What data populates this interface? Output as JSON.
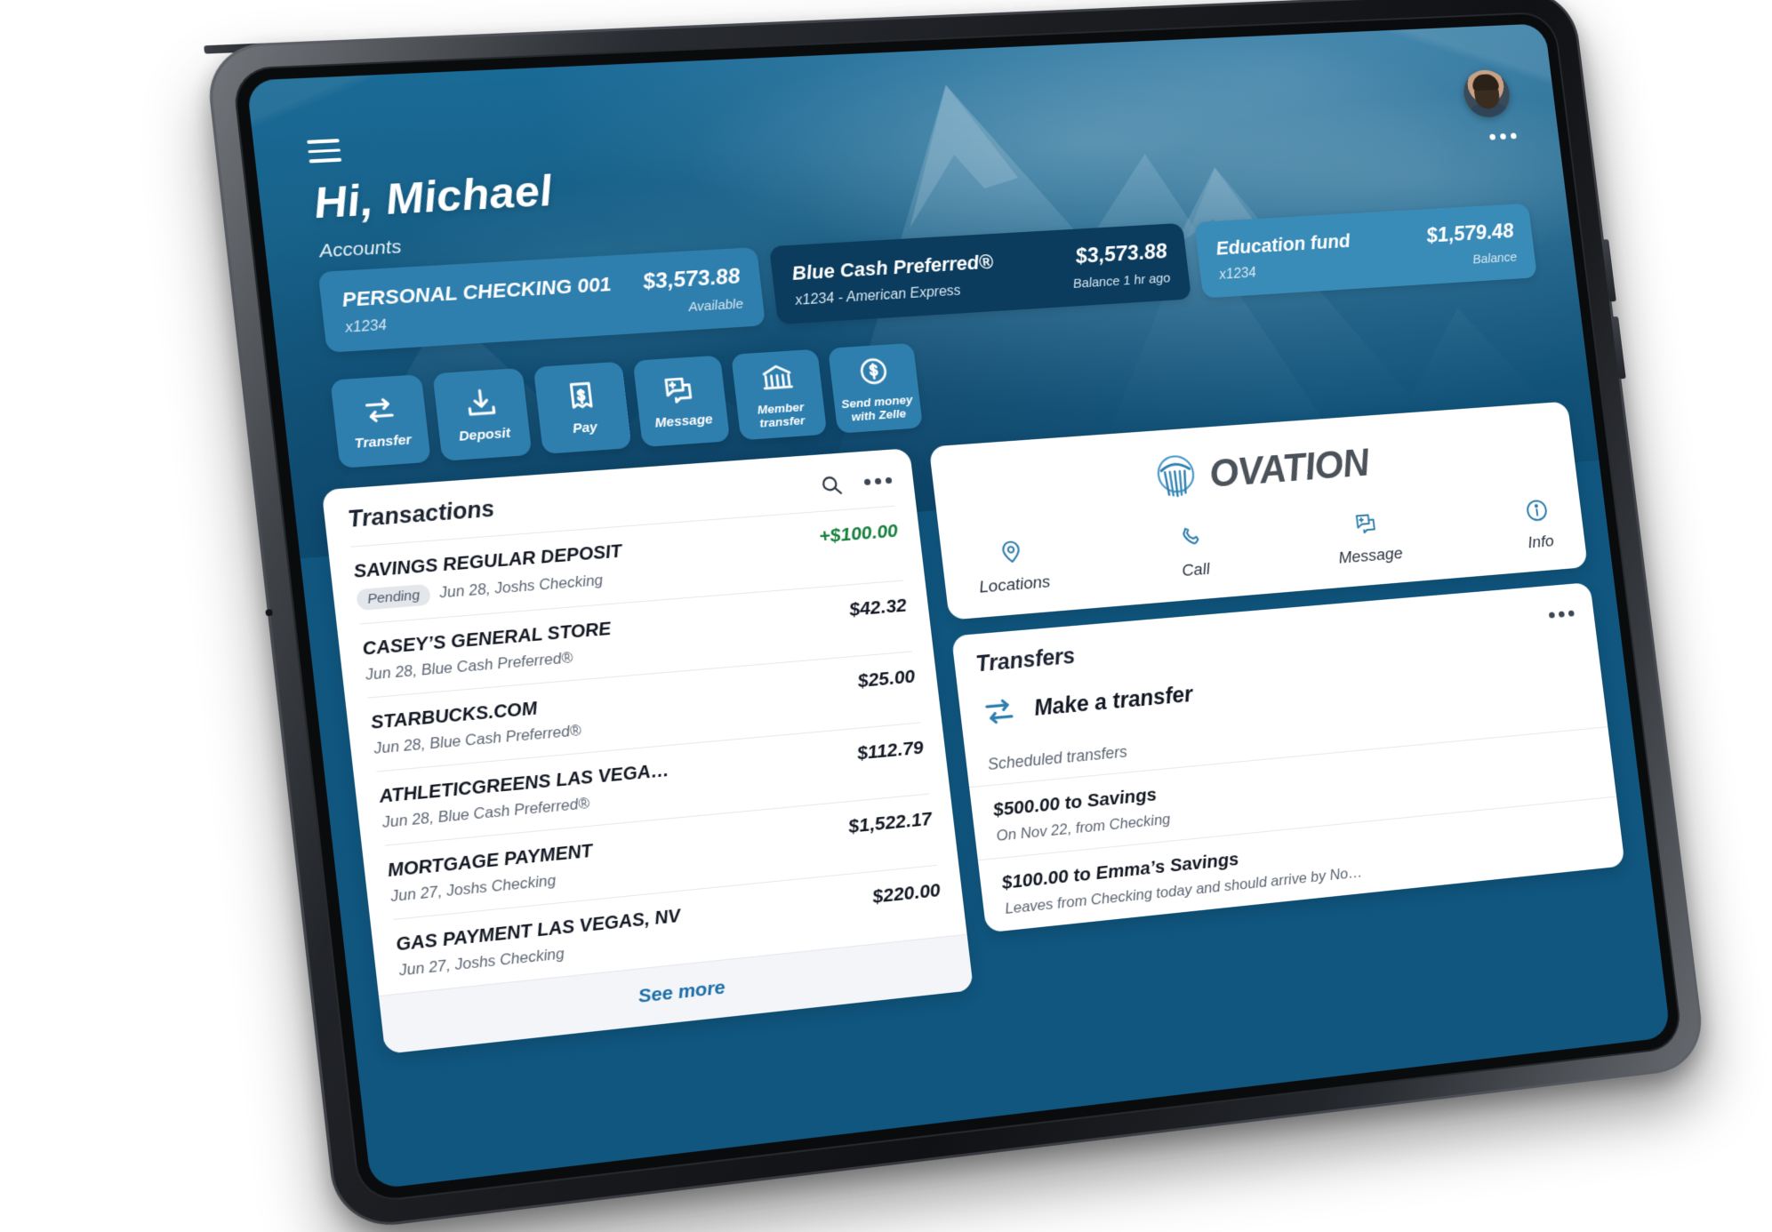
{
  "header": {
    "menu_icon": "hamburger-menu-icon",
    "greeting": "Hi, Michael",
    "accounts_label": "Accounts",
    "avatar": "user-avatar",
    "more_icon": "more-options-icon"
  },
  "accounts": [
    {
      "name": "PERSONAL CHECKING 001",
      "amount": "$3,573.88",
      "sub": "x1234",
      "status": "Available",
      "theme": "#2f7fae"
    },
    {
      "name": "Blue Cash Preferred®",
      "amount": "$3,573.88",
      "sub": "x1234 - American Express",
      "status": "Balance 1 hr ago",
      "theme": "#0b3c5d"
    },
    {
      "name": "Education fund",
      "amount": "$1,579.48",
      "sub": "x1234",
      "status": "Balance",
      "theme": "#3a8cb8"
    }
  ],
  "quick_actions": [
    {
      "label": "Transfer",
      "icon": "transfer-arrows-icon"
    },
    {
      "label": "Deposit",
      "icon": "deposit-download-icon"
    },
    {
      "label": "Pay",
      "icon": "pay-receipt-icon"
    },
    {
      "label": "Message",
      "icon": "message-plus-icon"
    },
    {
      "label": "Member transfer",
      "icon": "bank-building-icon"
    },
    {
      "label": "Send money with Zelle",
      "icon": "dollar-circle-icon"
    }
  ],
  "transactions_panel": {
    "title": "Transactions",
    "search_icon": "search-icon",
    "more_icon": "more-options-icon",
    "see_more": "See more",
    "rows": [
      {
        "name": "SAVINGS REGULAR DEPOSIT",
        "badge": "Pending",
        "meta": "Jun 28, Joshs Checking",
        "amount": "+$100.00",
        "positive": true
      },
      {
        "name": "CASEY’S GENERAL STORE",
        "badge": "",
        "meta": "Jun 28, Blue Cash Preferred®",
        "amount": "$42.32",
        "positive": false
      },
      {
        "name": "STARBUCKS.COM",
        "badge": "",
        "meta": "Jun 28, Blue Cash Preferred®",
        "amount": "$25.00",
        "positive": false
      },
      {
        "name": "ATHLETICGREENS LAS VEGA…",
        "badge": "",
        "meta": "Jun 28, Blue Cash Preferred®",
        "amount": "$112.79",
        "positive": false
      },
      {
        "name": "MORTGAGE PAYMENT",
        "badge": "",
        "meta": "Jun 27, Joshs Checking",
        "amount": "$1,522.17",
        "positive": false
      },
      {
        "name": "GAS PAYMENT LAS VEGAS, NV",
        "badge": "",
        "meta": "Jun 27, Joshs Checking",
        "amount": "$220.00",
        "positive": false
      }
    ]
  },
  "brand_panel": {
    "logo_icon": "ovation-pillar-logo-icon",
    "wordmark": "OVATION",
    "nav": [
      {
        "label": "Locations",
        "icon": "map-pin-icon"
      },
      {
        "label": "Call",
        "icon": "phone-icon"
      },
      {
        "label": "Message",
        "icon": "message-plus-icon"
      },
      {
        "label": "Info",
        "icon": "info-circle-icon"
      }
    ]
  },
  "transfers_panel": {
    "title": "Transfers",
    "more_icon": "more-options-icon",
    "make_transfer": "Make a transfer",
    "make_transfer_icon": "transfer-arrows-icon",
    "scheduled_label": "Scheduled transfers",
    "scheduled": [
      {
        "amount": "$500.00 to Savings",
        "sub": "On Nov 22, from Checking"
      },
      {
        "amount": "$100.00 to Emma’s Savings",
        "sub": "Leaves from Checking today and should arrive by No…"
      }
    ]
  },
  "colors": {
    "brand_blue": "#1b6ea8",
    "hero_blue": "#14567d",
    "card_light": "#2f7fae",
    "card_dark": "#0b3c5d",
    "card_mid": "#3a8cb8",
    "positive_green": "#17803d"
  }
}
